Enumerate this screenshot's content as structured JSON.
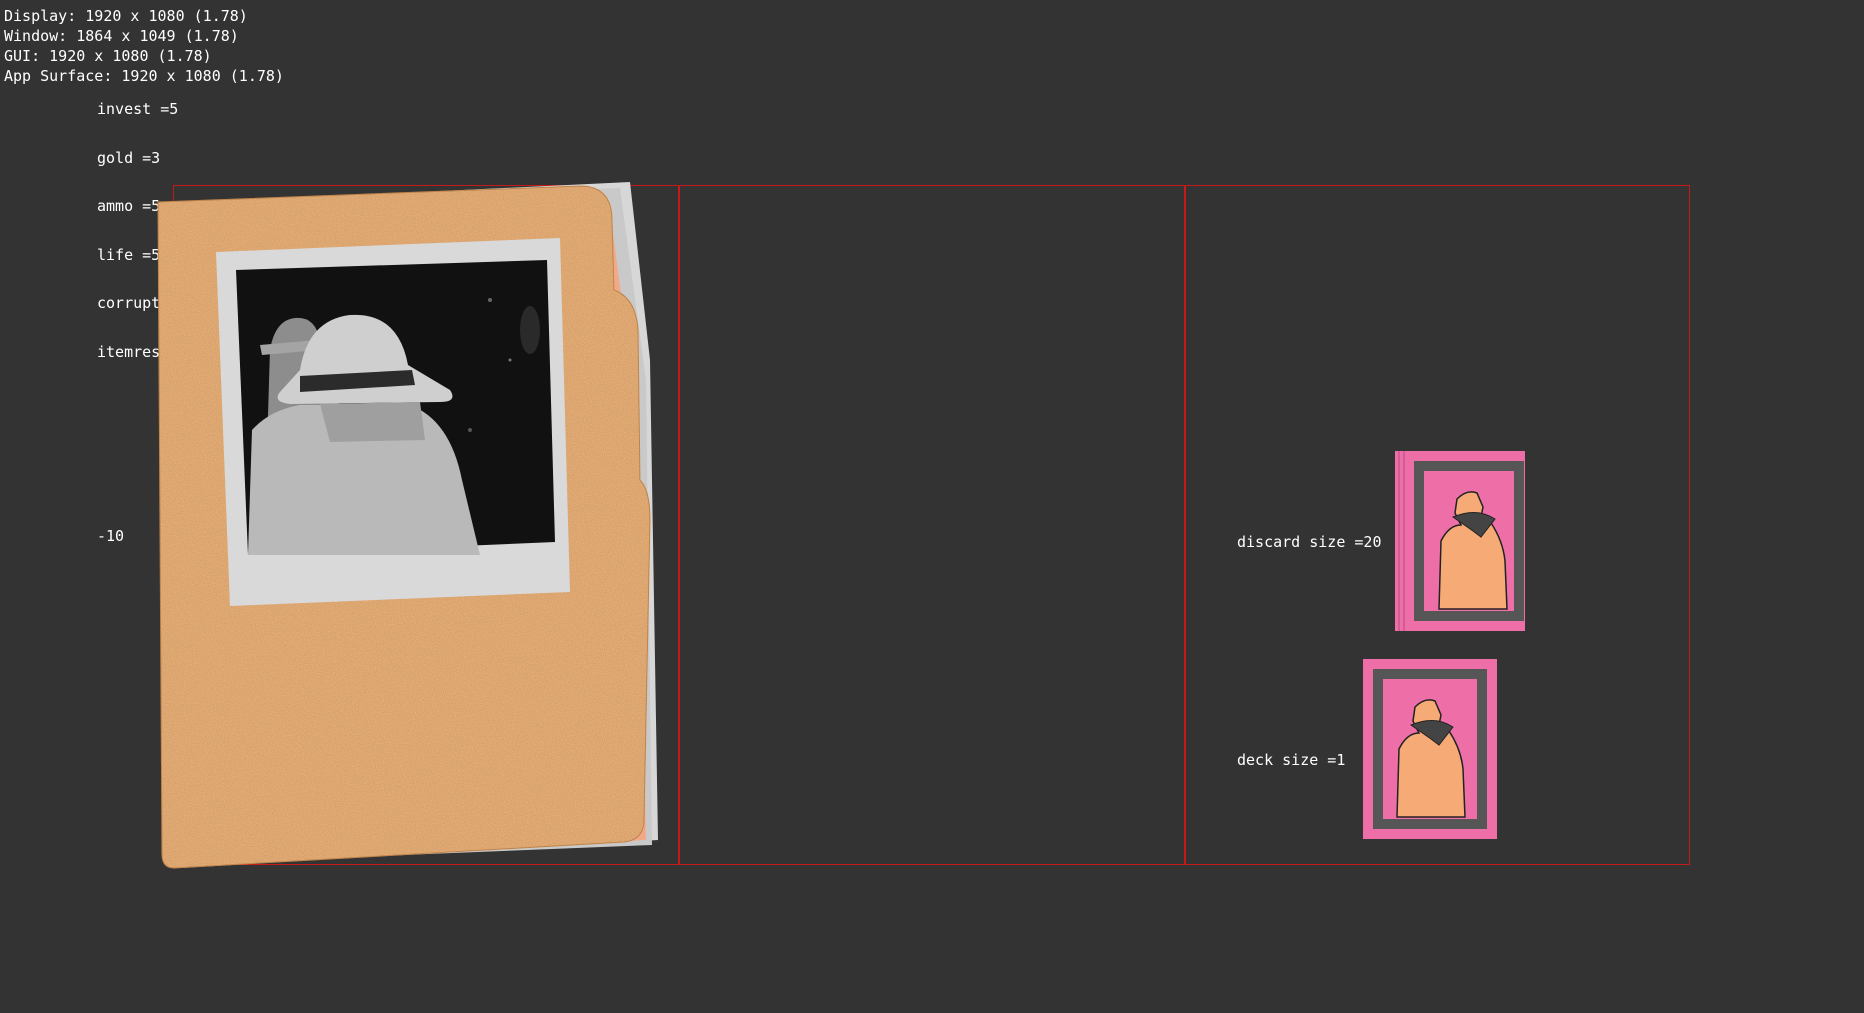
{
  "debug": {
    "display": "Display: 1920 x 1080 (1.78)",
    "window": "Window: 1864 x 1049 (1.78)",
    "gui": "GUI: 1920 x 1080 (1.78)",
    "app_surface": "App Surface: 1920 x 1080 (1.78)"
  },
  "stats": {
    "invest": "invest =5",
    "gold": "gold =3",
    "ammo": "ammo =5",
    "life": "life =5",
    "corrupt": "corrupt",
    "itemres": "itemres",
    "modifier": "-10"
  },
  "piles": {
    "discard_label": "discard size =20",
    "deck_label": "deck size =1"
  },
  "colors": {
    "background": "#333333",
    "zone_border": "#c41a1a",
    "folder": "#f2b476",
    "card_pink": "#ee6fa8",
    "card_frame": "#565656",
    "figure": "#f6aa76"
  }
}
